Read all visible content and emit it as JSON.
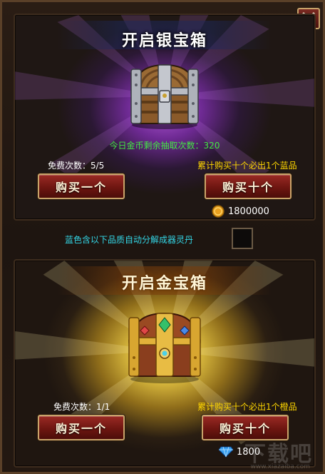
{
  "silver_chest": {
    "title": "开启银宝箱",
    "daily_coin_draws": "今日金币剩余抽取次数：320",
    "free_count": "免费次数：5/5",
    "bonus_hint": "累计购买十个必出1个蓝品",
    "buy_one_label": "购买一个",
    "buy_ten_label": "购买十个",
    "price": "1800000",
    "currency_icon": "gold-coin-icon"
  },
  "auto_decompose": {
    "label": "蓝色含以下品质自动分解成器灵丹",
    "checked": false
  },
  "gold_chest": {
    "title": "开启金宝箱",
    "free_count": "免费次数：1/1",
    "bonus_hint": "累计购买十个必出1个橙品",
    "buy_one_label": "购买一个",
    "buy_ten_label": "购买十个",
    "price": "1800",
    "currency_icon": "diamond-icon"
  },
  "watermark": {
    "logo": "下载吧",
    "url": "www.xiazaiba.com"
  },
  "colors": {
    "silver_glow": "#b35ad8",
    "gold_glow": "#e4c443",
    "count_text": "#44e844",
    "hint_text": "#ffd700",
    "toggle_label": "#33d6e6",
    "button_fill": "#7a1b15"
  }
}
